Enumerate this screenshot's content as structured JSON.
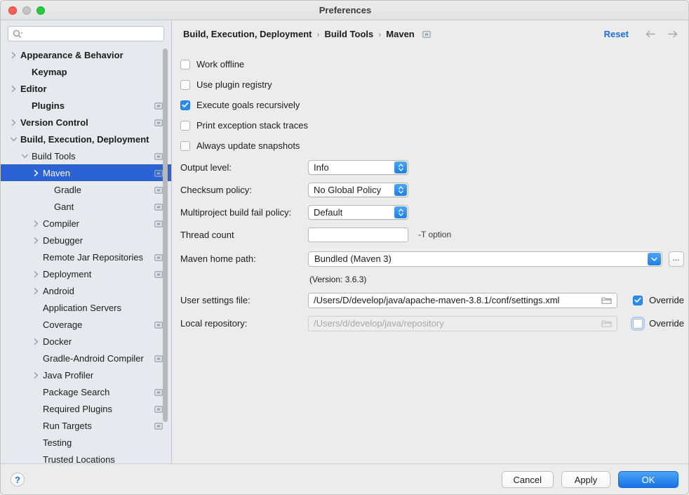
{
  "window": {
    "title": "Preferences",
    "traffic_lights": [
      "close",
      "minimize",
      "zoom"
    ]
  },
  "sidebar": {
    "search": {
      "placeholder": "",
      "value": "",
      "icon": "search-icon"
    },
    "items": [
      {
        "label": "Appearance & Behavior",
        "depth": 0,
        "arrow": "collapsed",
        "bold": true,
        "module": false
      },
      {
        "label": "Keymap",
        "depth": 1,
        "arrow": "none",
        "bold": true,
        "module": false
      },
      {
        "label": "Editor",
        "depth": 0,
        "arrow": "collapsed",
        "bold": true,
        "module": false
      },
      {
        "label": "Plugins",
        "depth": 1,
        "arrow": "none",
        "bold": true,
        "module": true
      },
      {
        "label": "Version Control",
        "depth": 0,
        "arrow": "collapsed",
        "bold": true,
        "module": true
      },
      {
        "label": "Build, Execution, Deployment",
        "depth": 0,
        "arrow": "expanded",
        "bold": true,
        "module": false
      },
      {
        "label": "Build Tools",
        "depth": 1,
        "arrow": "expanded",
        "bold": false,
        "module": true
      },
      {
        "label": "Maven",
        "depth": 2,
        "arrow": "collapsed",
        "bold": false,
        "module": true,
        "selected": true
      },
      {
        "label": "Gradle",
        "depth": 3,
        "arrow": "none",
        "bold": false,
        "module": true
      },
      {
        "label": "Gant",
        "depth": 3,
        "arrow": "none",
        "bold": false,
        "module": true
      },
      {
        "label": "Compiler",
        "depth": 2,
        "arrow": "collapsed",
        "bold": false,
        "module": true
      },
      {
        "label": "Debugger",
        "depth": 2,
        "arrow": "collapsed",
        "bold": false,
        "module": false
      },
      {
        "label": "Remote Jar Repositories",
        "depth": 2,
        "arrow": "none",
        "bold": false,
        "module": true
      },
      {
        "label": "Deployment",
        "depth": 2,
        "arrow": "collapsed",
        "bold": false,
        "module": true
      },
      {
        "label": "Android",
        "depth": 2,
        "arrow": "collapsed",
        "bold": false,
        "module": false
      },
      {
        "label": "Application Servers",
        "depth": 2,
        "arrow": "none",
        "bold": false,
        "module": false
      },
      {
        "label": "Coverage",
        "depth": 2,
        "arrow": "none",
        "bold": false,
        "module": true
      },
      {
        "label": "Docker",
        "depth": 2,
        "arrow": "collapsed",
        "bold": false,
        "module": false
      },
      {
        "label": "Gradle-Android Compiler",
        "depth": 2,
        "arrow": "none",
        "bold": false,
        "module": true
      },
      {
        "label": "Java Profiler",
        "depth": 2,
        "arrow": "collapsed",
        "bold": false,
        "module": false
      },
      {
        "label": "Package Search",
        "depth": 2,
        "arrow": "none",
        "bold": false,
        "module": true
      },
      {
        "label": "Required Plugins",
        "depth": 2,
        "arrow": "none",
        "bold": false,
        "module": true
      },
      {
        "label": "Run Targets",
        "depth": 2,
        "arrow": "none",
        "bold": false,
        "module": true
      },
      {
        "label": "Testing",
        "depth": 2,
        "arrow": "none",
        "bold": false,
        "module": false
      },
      {
        "label": "Trusted Locations",
        "depth": 2,
        "arrow": "none",
        "bold": false,
        "module": false
      }
    ],
    "scrollbar": {
      "visible": true
    }
  },
  "header": {
    "breadcrumb": [
      "Build, Execution, Deployment",
      "Build Tools",
      "Maven"
    ],
    "separator": "›",
    "module_icon": "module-icon",
    "reset_label": "Reset",
    "back_icon": "arrow-left-icon",
    "forward_icon": "arrow-right-icon"
  },
  "main": {
    "checkboxes": [
      {
        "label": "Work offline",
        "checked": false,
        "focused": false
      },
      {
        "label": "Use plugin registry",
        "checked": false,
        "focused": false
      },
      {
        "label": "Execute goals recursively",
        "checked": true,
        "focused": false
      },
      {
        "label": "Print exception stack traces",
        "checked": false,
        "focused": false
      },
      {
        "label": "Always update snapshots",
        "checked": false,
        "focused": false
      }
    ],
    "output_level": {
      "label": "Output level:",
      "value": "Info"
    },
    "checksum_policy": {
      "label": "Checksum policy:",
      "value": "No Global Policy"
    },
    "fail_policy": {
      "label": "Multiproject build fail policy:",
      "value": "Default"
    },
    "thread_count": {
      "label": "Thread count",
      "value": "",
      "hint": "-T option"
    },
    "maven_home": {
      "label": "Maven home path:",
      "value": "Bundled (Maven 3)",
      "browse_label": "…"
    },
    "version_note": "(Version: 3.6.3)",
    "user_settings": {
      "label": "User settings file:",
      "value": "/Users/D/develop/java/apache-maven-3.8.1/conf/settings.xml",
      "override_label": "Override",
      "override_checked": true,
      "override_focused": false,
      "disabled": false
    },
    "local_repository": {
      "label": "Local repository:",
      "value": "/Users/d/develop/java/repository",
      "override_label": "Override",
      "override_checked": false,
      "override_focused": true,
      "disabled": true
    }
  },
  "footer": {
    "help_label": "?",
    "cancel_label": "Cancel",
    "apply_label": "Apply",
    "ok_label": "OK"
  },
  "colors": {
    "accent_blue": "#2b62d4",
    "link_blue": "#1a6ed8",
    "checkbox_blue": "#2b8bf2",
    "sidebar_bg": "#e6eaee",
    "panel_bg": "#ececec"
  }
}
